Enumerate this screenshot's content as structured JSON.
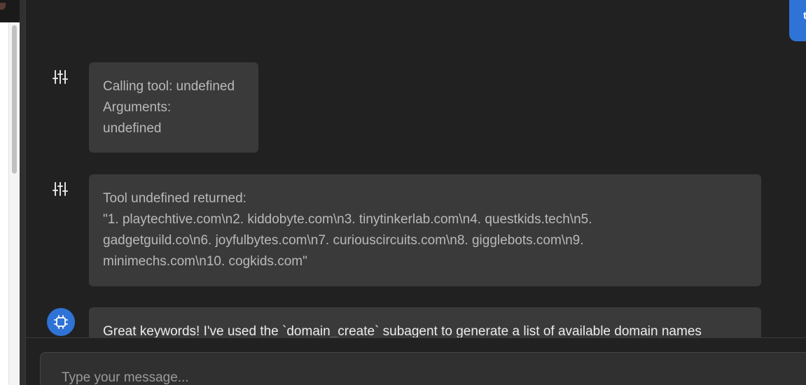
{
  "user_bubble": {
    "visible_char": "t"
  },
  "messages": [
    {
      "role": "tool-call",
      "icon": "sliders-icon",
      "lines": [
        "Calling tool: undefined",
        "Arguments:",
        "undefined"
      ]
    },
    {
      "role": "tool-result",
      "icon": "sliders-icon",
      "lines": [
        "Tool undefined returned:",
        "\"1. playtechtive.com\\n2. kiddobyte.com\\n3. tinytinkerlab.com\\n4. questkids.tech\\n5.",
        "gadgetguild.co\\n6. joyfulbytes.com\\n7. curiouscircuits.com\\n8. gigglebots.com\\n9.",
        "minimechs.com\\n10. cogkids.com\""
      ]
    },
    {
      "role": "assistant",
      "icon": "chip-icon",
      "lines": [
        "Great keywords! I've used the `domain_create` subagent to generate a list of available domain names"
      ]
    }
  ],
  "composer": {
    "placeholder": "Type your message..."
  },
  "colors": {
    "accent": "#2f73d6",
    "bubble": "#3a3a3a",
    "background": "#212121"
  }
}
